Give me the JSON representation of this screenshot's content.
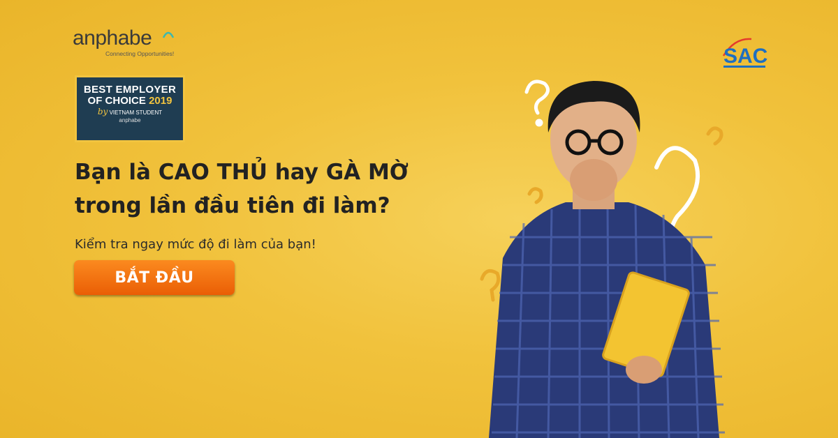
{
  "logo": {
    "name": "anphabe",
    "tagline": "Connecting Opportunities!"
  },
  "award": {
    "line1": "BEST EMPLOYER",
    "line2_prefix": "OF CHOICE",
    "year": "2019",
    "by": "by",
    "line3": "VIETNAM STUDENT",
    "brand": "anphabe"
  },
  "headline": {
    "line1": "Bạn là CAO THỦ hay GÀ MỜ",
    "line2": "trong lần đầu tiên đi làm?"
  },
  "subline": "Kiểm tra ngay mức độ đi làm của bạn!",
  "cta": {
    "label": "BẮT ĐẦU"
  },
  "partner_logo": {
    "text": "SAC"
  },
  "colors": {
    "background": "#f1c23c",
    "button": "#f57a12",
    "award_bg": "#1f3d52",
    "accent": "#f2c43f"
  },
  "icons": [
    "question-mark-doodle",
    "exclamation-doodle"
  ]
}
